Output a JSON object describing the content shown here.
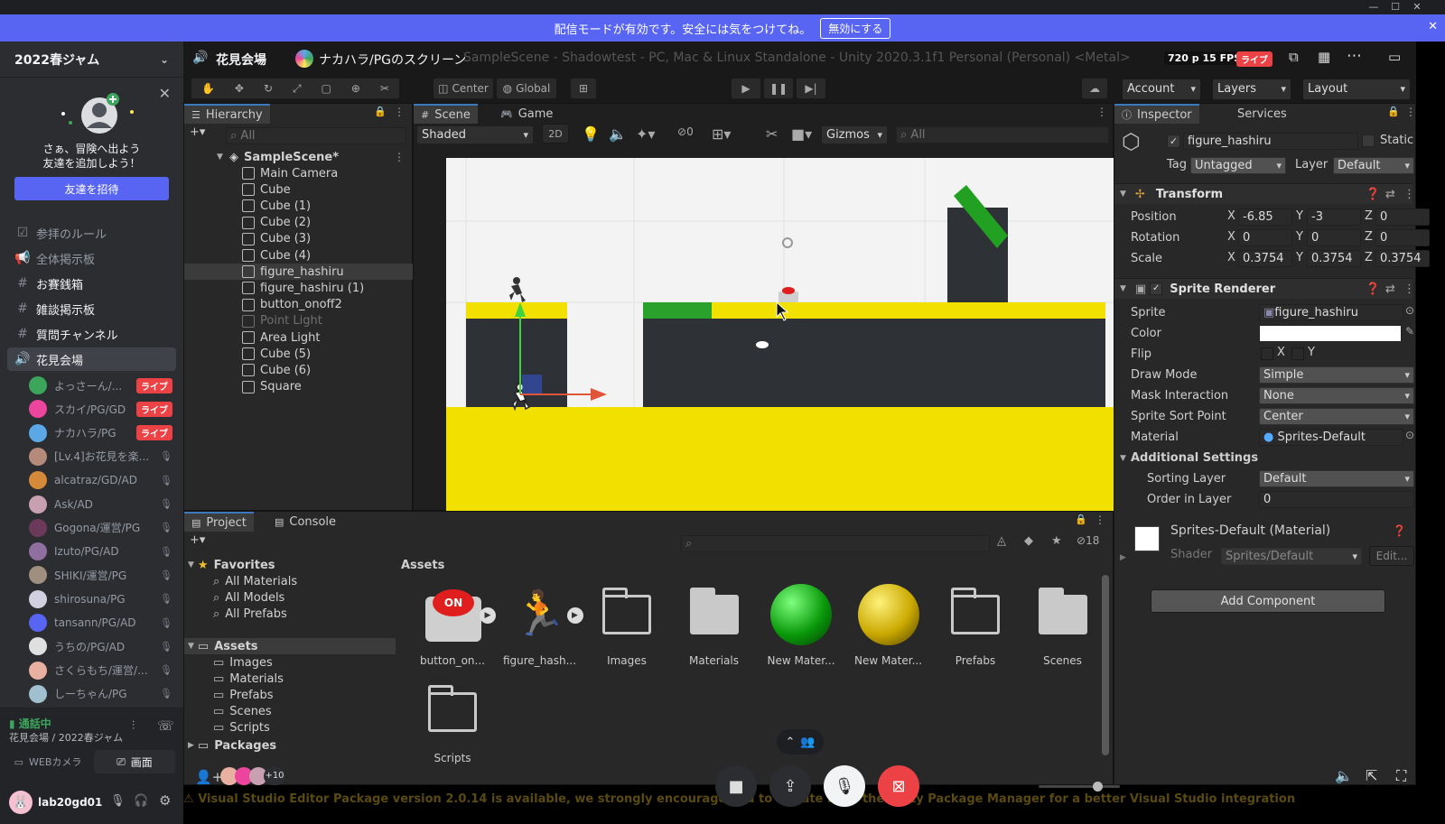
{
  "banner": {
    "message": "配信モードが有効です。安全には気をつけてね。",
    "disable_label": "無効にする"
  },
  "window_controls": {
    "minimize": "—",
    "maximize": "☐",
    "close": "✕"
  },
  "sidebar": {
    "server_name": "2022春ジャム",
    "friend_card": {
      "line1": "さぁ、冒険へ出よう",
      "line2": "友達を追加しよう！",
      "invite_label": "友達を招待"
    },
    "channels": [
      {
        "name": "参拝のルール",
        "icon": "☑"
      },
      {
        "name": "全体掲示板",
        "icon": "📢"
      },
      {
        "name": "お賽銭箱",
        "icon": "#"
      },
      {
        "name": "雑談掲示板",
        "icon": "#"
      },
      {
        "name": "質問チャンネル",
        "icon": "#"
      },
      {
        "name": "花見会場",
        "icon": "🔊"
      }
    ],
    "voice_users": [
      {
        "name": "よっさーん/...",
        "live": "ライブ",
        "color": "#3ba55c"
      },
      {
        "name": "スカイ/PG/GD",
        "live": "ライブ",
        "color": "#eb459e"
      },
      {
        "name": "ナカハラ/PG",
        "live": "ライブ",
        "color": "#5aa9e6"
      },
      {
        "name": "[Lv.4]お花見を楽...",
        "live": "",
        "color": "#b58a7a"
      },
      {
        "name": "alcatraz/GD/AD",
        "live": "",
        "color": "#d58a3a"
      },
      {
        "name": "Ask/AD",
        "live": "",
        "color": "#c9a0b0"
      },
      {
        "name": "Gogona/運営/PG",
        "live": "",
        "color": "#6b3a5a"
      },
      {
        "name": "Izuto/PG/AD",
        "live": "",
        "color": "#8f6f9f"
      },
      {
        "name": "SHIKI/運営/PG",
        "live": "",
        "color": "#9f8f7f"
      },
      {
        "name": "shirosuna/PG",
        "live": "",
        "color": "#d0d0e0"
      },
      {
        "name": "tansann/PG/AD",
        "live": "",
        "color": "#5865f2"
      },
      {
        "name": "うちの/PG/AD",
        "live": "",
        "color": "#e0e0e0"
      },
      {
        "name": "さくらもち/運営/...",
        "live": "",
        "color": "#e8b0a0"
      },
      {
        "name": "しーちゃん/PG",
        "live": "",
        "color": "#a0c0d0"
      }
    ],
    "voice_status": {
      "title": "通話中",
      "location": "花見会場 / 2022春ジャム",
      "webcam_label": "WEBカメラ",
      "screen_label": "画面"
    },
    "user": {
      "name": "lab20gd01"
    }
  },
  "stream_header": {
    "channel": "花見会場",
    "screen_name": "ナカハラ/PGのスクリーン",
    "window_title": "SampleScene - Shadowtest - PC, Mac & Linux Standalone - Unity 2020.3.1f1 Personal (Personal) <Metal>",
    "quality": "720 p 15 FPS",
    "live": "ライブ"
  },
  "unity": {
    "toolbar": {
      "pivot": "Center",
      "space": "Global",
      "account": "Account",
      "layers": "Layers",
      "layout": "Layout"
    },
    "hierarchy": {
      "tab": "Hierarchy",
      "search_placeholder": "All",
      "scene": "SampleScene*",
      "items": [
        "Main Camera",
        "Cube",
        "Cube (1)",
        "Cube (2)",
        "Cube (3)",
        "Cube (4)",
        "figure_hashiru",
        "figure_hashiru (1)",
        "button_onoff2",
        "Point Light",
        "Area Light",
        "Cube (5)",
        "Cube (6)",
        "Square"
      ]
    },
    "scene_view": {
      "tab_scene": "Scene",
      "tab_game": "Game",
      "shading": "Shaded",
      "mode_2d": "2D",
      "hidden_count": "0",
      "gizmos": "Gizmos",
      "search_placeholder": "All"
    },
    "inspector": {
      "tab": "Inspector",
      "tab_services": "Services",
      "object_name": "figure_hashiru",
      "static_label": "Static",
      "tag_label": "Tag",
      "tag": "Untagged",
      "layer_label": "Layer",
      "layer": "Default",
      "transform": {
        "title": "Transform",
        "position_label": "Position",
        "rotation_label": "Rotation",
        "scale_label": "Scale",
        "position": {
          "x": "-6.85",
          "y": "-3",
          "z": "0"
        },
        "rotation": {
          "x": "0",
          "y": "0",
          "z": "0"
        },
        "scale": {
          "x": "0.3754",
          "y": "0.3754",
          "z": "0.3754"
        }
      },
      "sprite_renderer": {
        "title": "Sprite Renderer",
        "sprite_label": "Sprite",
        "sprite": "figure_hashiru",
        "color_label": "Color",
        "flip_label": "Flip",
        "draw_mode_label": "Draw Mode",
        "draw_mode": "Simple",
        "mask_label": "Mask Interaction",
        "mask": "None",
        "sort_point_label": "Sprite Sort Point",
        "sort_point": "Center",
        "material_label": "Material",
        "material": "Sprites-Default",
        "additional": "Additional Settings",
        "sorting_layer_label": "Sorting Layer",
        "sorting_layer": "Default",
        "order_label": "Order in Layer",
        "order": "0"
      },
      "material_block": {
        "title": "Sprites-Default (Material)",
        "shader_label": "Shader",
        "shader": "Sprites/Default",
        "edit": "Edit..."
      },
      "add_component": "Add Component"
    },
    "project": {
      "tab_project": "Project",
      "tab_console": "Console",
      "hidden_count": "18",
      "favorites": "Favorites",
      "fav_items": [
        "All Materials",
        "All Models",
        "All Prefabs"
      ],
      "assets_root": "Assets",
      "folders": [
        "Images",
        "Materials",
        "Prefabs",
        "Scenes",
        "Scripts"
      ],
      "packages": "Packages",
      "breadcrumb": "Assets",
      "assets": [
        {
          "name": "button_on...",
          "kind": "button"
        },
        {
          "name": "figure_hash...",
          "kind": "figure"
        },
        {
          "name": "Images",
          "kind": "folder"
        },
        {
          "name": "Materials",
          "kind": "folder-filled"
        },
        {
          "name": "New Mater...",
          "kind": "sphere-green"
        },
        {
          "name": "New Mater...",
          "kind": "sphere-yellow"
        },
        {
          "name": "Prefabs",
          "kind": "folder"
        },
        {
          "name": "Scenes",
          "kind": "folder-filled"
        },
        {
          "name": "Scripts",
          "kind": "folder"
        }
      ],
      "button_badge": "ON"
    },
    "status_bar": "Visual Studio Editor Package version 2.0.14 is available, we strongly encourage you to update from the Unity Package Manager for a better Visual Studio integration"
  },
  "call_controls": {
    "participants_extra": "+10"
  },
  "colors": {
    "discord_blurple": "#5865f2",
    "live_red": "#ed4245",
    "unity_selection": "#3a79bb",
    "ground_yellow": "#f2e000",
    "platform_green": "#2aa12a"
  }
}
